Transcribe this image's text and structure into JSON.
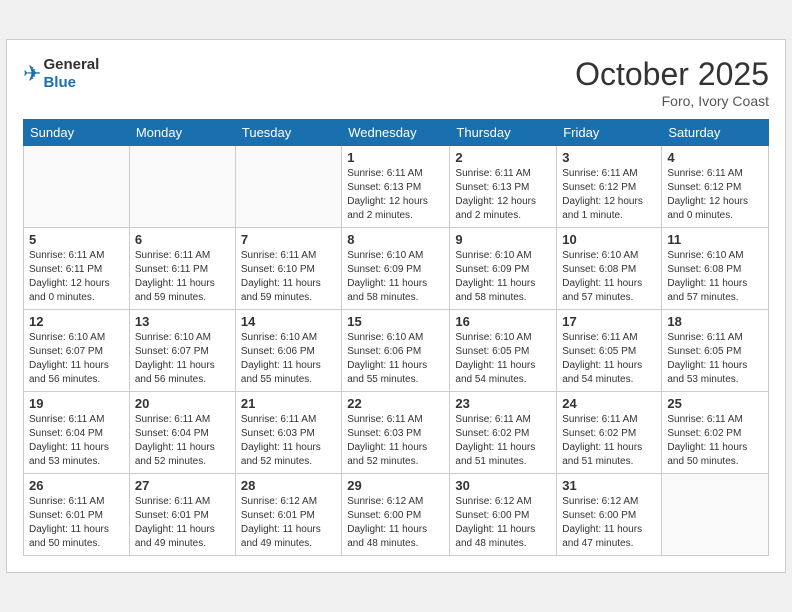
{
  "header": {
    "logo_general": "General",
    "logo_blue": "Blue",
    "month_title": "October 2025",
    "location": "Foro, Ivory Coast"
  },
  "weekdays": [
    "Sunday",
    "Monday",
    "Tuesday",
    "Wednesday",
    "Thursday",
    "Friday",
    "Saturday"
  ],
  "weeks": [
    [
      {
        "day": "",
        "info": ""
      },
      {
        "day": "",
        "info": ""
      },
      {
        "day": "",
        "info": ""
      },
      {
        "day": "1",
        "info": "Sunrise: 6:11 AM\nSunset: 6:13 PM\nDaylight: 12 hours\nand 2 minutes."
      },
      {
        "day": "2",
        "info": "Sunrise: 6:11 AM\nSunset: 6:13 PM\nDaylight: 12 hours\nand 2 minutes."
      },
      {
        "day": "3",
        "info": "Sunrise: 6:11 AM\nSunset: 6:12 PM\nDaylight: 12 hours\nand 1 minute."
      },
      {
        "day": "4",
        "info": "Sunrise: 6:11 AM\nSunset: 6:12 PM\nDaylight: 12 hours\nand 0 minutes."
      }
    ],
    [
      {
        "day": "5",
        "info": "Sunrise: 6:11 AM\nSunset: 6:11 PM\nDaylight: 12 hours\nand 0 minutes."
      },
      {
        "day": "6",
        "info": "Sunrise: 6:11 AM\nSunset: 6:11 PM\nDaylight: 11 hours\nand 59 minutes."
      },
      {
        "day": "7",
        "info": "Sunrise: 6:11 AM\nSunset: 6:10 PM\nDaylight: 11 hours\nand 59 minutes."
      },
      {
        "day": "8",
        "info": "Sunrise: 6:10 AM\nSunset: 6:09 PM\nDaylight: 11 hours\nand 58 minutes."
      },
      {
        "day": "9",
        "info": "Sunrise: 6:10 AM\nSunset: 6:09 PM\nDaylight: 11 hours\nand 58 minutes."
      },
      {
        "day": "10",
        "info": "Sunrise: 6:10 AM\nSunset: 6:08 PM\nDaylight: 11 hours\nand 57 minutes."
      },
      {
        "day": "11",
        "info": "Sunrise: 6:10 AM\nSunset: 6:08 PM\nDaylight: 11 hours\nand 57 minutes."
      }
    ],
    [
      {
        "day": "12",
        "info": "Sunrise: 6:10 AM\nSunset: 6:07 PM\nDaylight: 11 hours\nand 56 minutes."
      },
      {
        "day": "13",
        "info": "Sunrise: 6:10 AM\nSunset: 6:07 PM\nDaylight: 11 hours\nand 56 minutes."
      },
      {
        "day": "14",
        "info": "Sunrise: 6:10 AM\nSunset: 6:06 PM\nDaylight: 11 hours\nand 55 minutes."
      },
      {
        "day": "15",
        "info": "Sunrise: 6:10 AM\nSunset: 6:06 PM\nDaylight: 11 hours\nand 55 minutes."
      },
      {
        "day": "16",
        "info": "Sunrise: 6:10 AM\nSunset: 6:05 PM\nDaylight: 11 hours\nand 54 minutes."
      },
      {
        "day": "17",
        "info": "Sunrise: 6:11 AM\nSunset: 6:05 PM\nDaylight: 11 hours\nand 54 minutes."
      },
      {
        "day": "18",
        "info": "Sunrise: 6:11 AM\nSunset: 6:05 PM\nDaylight: 11 hours\nand 53 minutes."
      }
    ],
    [
      {
        "day": "19",
        "info": "Sunrise: 6:11 AM\nSunset: 6:04 PM\nDaylight: 11 hours\nand 53 minutes."
      },
      {
        "day": "20",
        "info": "Sunrise: 6:11 AM\nSunset: 6:04 PM\nDaylight: 11 hours\nand 52 minutes."
      },
      {
        "day": "21",
        "info": "Sunrise: 6:11 AM\nSunset: 6:03 PM\nDaylight: 11 hours\nand 52 minutes."
      },
      {
        "day": "22",
        "info": "Sunrise: 6:11 AM\nSunset: 6:03 PM\nDaylight: 11 hours\nand 52 minutes."
      },
      {
        "day": "23",
        "info": "Sunrise: 6:11 AM\nSunset: 6:02 PM\nDaylight: 11 hours\nand 51 minutes."
      },
      {
        "day": "24",
        "info": "Sunrise: 6:11 AM\nSunset: 6:02 PM\nDaylight: 11 hours\nand 51 minutes."
      },
      {
        "day": "25",
        "info": "Sunrise: 6:11 AM\nSunset: 6:02 PM\nDaylight: 11 hours\nand 50 minutes."
      }
    ],
    [
      {
        "day": "26",
        "info": "Sunrise: 6:11 AM\nSunset: 6:01 PM\nDaylight: 11 hours\nand 50 minutes."
      },
      {
        "day": "27",
        "info": "Sunrise: 6:11 AM\nSunset: 6:01 PM\nDaylight: 11 hours\nand 49 minutes."
      },
      {
        "day": "28",
        "info": "Sunrise: 6:12 AM\nSunset: 6:01 PM\nDaylight: 11 hours\nand 49 minutes."
      },
      {
        "day": "29",
        "info": "Sunrise: 6:12 AM\nSunset: 6:00 PM\nDaylight: 11 hours\nand 48 minutes."
      },
      {
        "day": "30",
        "info": "Sunrise: 6:12 AM\nSunset: 6:00 PM\nDaylight: 11 hours\nand 48 minutes."
      },
      {
        "day": "31",
        "info": "Sunrise: 6:12 AM\nSunset: 6:00 PM\nDaylight: 11 hours\nand 47 minutes."
      },
      {
        "day": "",
        "info": ""
      }
    ]
  ]
}
